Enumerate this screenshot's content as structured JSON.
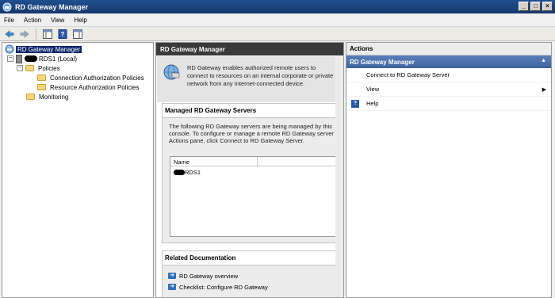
{
  "window": {
    "title": "RD Gateway Manager"
  },
  "menu": {
    "file": "File",
    "action": "Action",
    "view": "View",
    "help": "Help"
  },
  "tree": {
    "root": "RD Gateway Manager",
    "server": "RDS1 (Local)",
    "policies": "Policies",
    "cap": "Connection Authorization Policies",
    "rap": "Resource Authorization Policies",
    "monitoring": "Monitoring"
  },
  "center": {
    "header": "RD Gateway Manager",
    "intro": "RD Gateway enables authorized remote users to connect to resources on an internal corporate or private network from any Internet-connected device.",
    "managed": {
      "title": "Managed RD Gateway Servers",
      "line1": "The following RD Gateway servers are being managed by this",
      "line2": "console. To configure or manage a remote RD Gateway server",
      "line3": "Actions pane, click Connect to RD Gateway Server.",
      "column": "Name",
      "row": "RDS1"
    },
    "docs": {
      "title": "Related Documentation",
      "link1": "RD Gateway overview",
      "link2": "Checklist: Configure RD Gateway"
    }
  },
  "actions": {
    "header": "Actions",
    "section": "RD Gateway Manager",
    "connect": "Connect to RD Gateway Server",
    "view": "View",
    "help": "Help"
  }
}
